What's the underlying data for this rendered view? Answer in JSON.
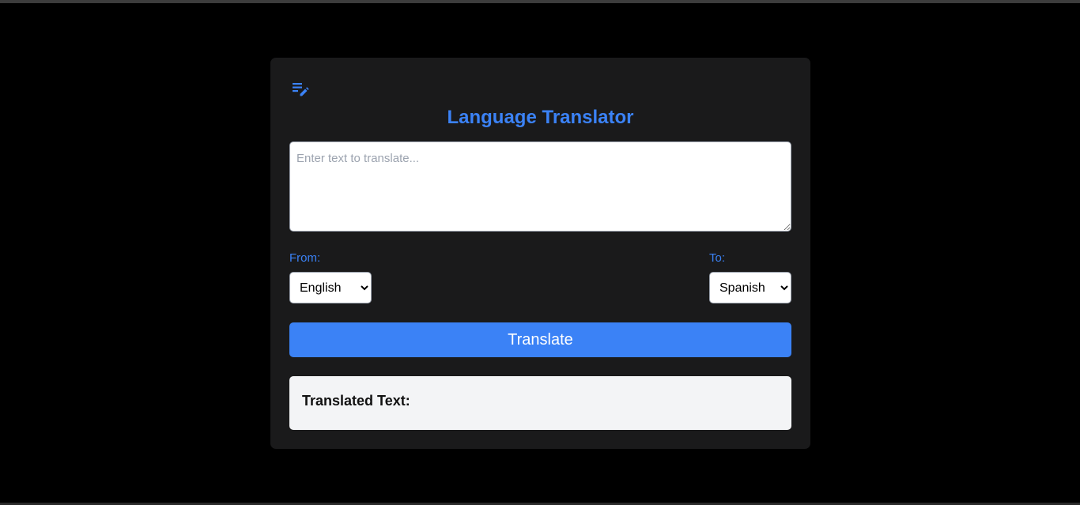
{
  "app": {
    "title": "Language Translator",
    "icon": "edit-note-icon"
  },
  "input": {
    "placeholder": "Enter text to translate...",
    "value": ""
  },
  "from": {
    "label": "From:",
    "selected": "English"
  },
  "to": {
    "label": "To:",
    "selected": "Spanish"
  },
  "translate_button": {
    "label": "Translate"
  },
  "result": {
    "heading": "Translated Text:",
    "text": ""
  },
  "colors": {
    "accent": "#3b82f6",
    "background": "#000000",
    "card": "#1a1a1b",
    "result_bg": "#f3f4f6"
  }
}
